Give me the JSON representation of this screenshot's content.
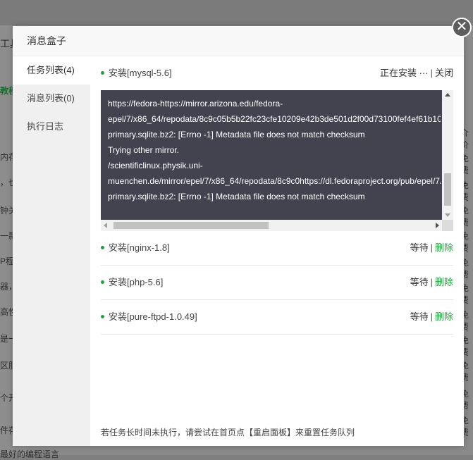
{
  "modal": {
    "title": "消息盒子",
    "close_glyph": "✕"
  },
  "sidebar": {
    "items": [
      {
        "label": "任务列表(4)",
        "active": true
      },
      {
        "label": "消息列表(0)",
        "active": false
      },
      {
        "label": "执行日志",
        "active": false
      }
    ]
  },
  "tasks": [
    {
      "label": "安装[mysql-5.6]",
      "status": "正在安装 ···",
      "action": "关闭",
      "log": [
        "https://fedora-https://mirror.arizona.edu/fedora-",
        "epel/7/x86_64/repodata/8c9c05b5b22fc23cfe10209e42b3de501d2f00d73100fef4ef61b10",
        "primary.sqlite.bz2: [Errno -1] Metadata file does not match checksum",
        "Trying other mirror.",
        "/scientificlinux.physik.uni-",
        "muenchen.de/mirror/epel/7/x86_64/repodata/8c9c0https://dl.fedoraproject.org/pub/epel/7/",
        "primary.sqlite.bz2: [Errno -1] Metadata file does not match checksum"
      ]
    },
    {
      "label": "安装[nginx-1.8]",
      "status": "等待",
      "action": "删除"
    },
    {
      "label": "安装[php-5.6]",
      "status": "等待",
      "action": "删除"
    },
    {
      "label": "安装[pure-ftpd-1.0.49]",
      "status": "等待",
      "action": "删除"
    }
  ],
  "footer_tip": "若任务长时间未执行，请尝试在首页点【重启面板】来重置任务队列",
  "background": {
    "left_texts": [
      "工具",
      "教程",
      "内存",
      "，也",
      "钟关",
      "一款",
      "P程",
      "器，",
      "高性",
      "是一",
      "区服",
      "个开",
      "件存",
      "最好的编程语言"
    ],
    "right_texts": [
      "介价",
      "免费",
      "免费",
      "免费",
      "免费",
      "免费",
      "免费",
      "免费",
      "免费",
      "免费",
      "免费",
      "免费"
    ]
  },
  "colors": {
    "accent": "#20a53a",
    "log_bg": "#43424f"
  }
}
